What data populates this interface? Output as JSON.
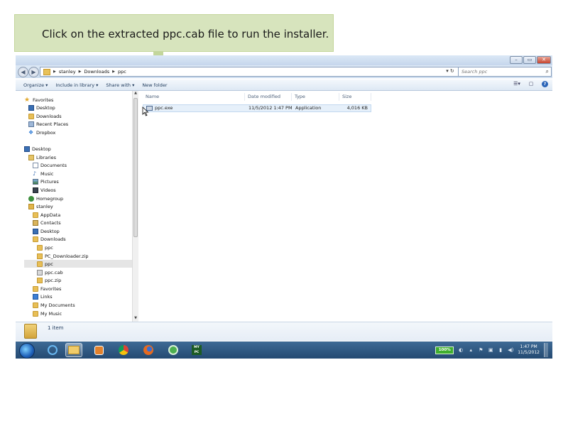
{
  "instruction": "Click on the extracted ppc.cab file to run the installer.",
  "address": {
    "crumbs": [
      "stanley",
      "Downloads",
      "ppc"
    ],
    "search_placeholder": "Search ppc"
  },
  "window_buttons": [
    "–",
    "▭",
    "✕"
  ],
  "toolbar": {
    "organize": "Organize ▾",
    "include_library": "Include in library ▾",
    "share_with": "Share with ▾",
    "new_folder": "New folder"
  },
  "nav_items": [
    {
      "label": "Favorites",
      "icon": "star-icon"
    },
    {
      "label": "Desktop",
      "icon": "desktop-icon"
    },
    {
      "label": "Downloads",
      "icon": "downloads-folder-icon"
    },
    {
      "label": "Recent Places",
      "icon": "recent-places-icon"
    },
    {
      "label": "Dropbox",
      "icon": "dropbox-icon"
    },
    {
      "label": "Desktop",
      "icon": "desktop-icon"
    },
    {
      "label": "Libraries",
      "icon": "libraries-icon"
    },
    {
      "label": "Documents",
      "icon": "documents-icon"
    },
    {
      "label": "Music",
      "icon": "music-icon"
    },
    {
      "label": "Pictures",
      "icon": "pictures-icon"
    },
    {
      "label": "Videos",
      "icon": "videos-icon"
    },
    {
      "label": "Homegroup",
      "icon": "homegroup-icon"
    },
    {
      "label": "stanley",
      "icon": "user-folder-icon"
    },
    {
      "label": "AppData",
      "icon": "folder-icon"
    },
    {
      "label": "Contacts",
      "icon": "contacts-icon"
    },
    {
      "label": "Desktop",
      "icon": "desktop-folder-icon"
    },
    {
      "label": "Downloads",
      "icon": "downloads-folder-icon"
    },
    {
      "label": "ppc",
      "icon": "folder-icon"
    },
    {
      "label": "PC_Downloader.zip",
      "icon": "zip-icon"
    },
    {
      "label": "ppc",
      "icon": "folder-icon"
    },
    {
      "label": "ppc.cab",
      "icon": "cab-file-icon"
    },
    {
      "label": "ppc.zip",
      "icon": "zip-icon"
    },
    {
      "label": "Favorites",
      "icon": "favorites-folder-icon"
    },
    {
      "label": "Links",
      "icon": "links-icon"
    },
    {
      "label": "My Documents",
      "icon": "folder-icon"
    },
    {
      "label": "My Music",
      "icon": "music-folder-icon"
    }
  ],
  "columns": [
    "Name",
    "Date modified",
    "Type",
    "Size"
  ],
  "files": [
    {
      "name": "ppc.exe",
      "date": "11/5/2012 1:47 PM",
      "type": "Application",
      "size": "4,016 KB"
    }
  ],
  "details": {
    "count": "1 item"
  },
  "taskbar": {
    "battery": "100%",
    "time": "1:47 PM",
    "date": "11/5/2012",
    "pinned_label": "MY PC"
  },
  "colors": {
    "callout_bg": "#d7e4bd",
    "arrow": "#c3d69b",
    "taskbar": "#2f5a86"
  }
}
